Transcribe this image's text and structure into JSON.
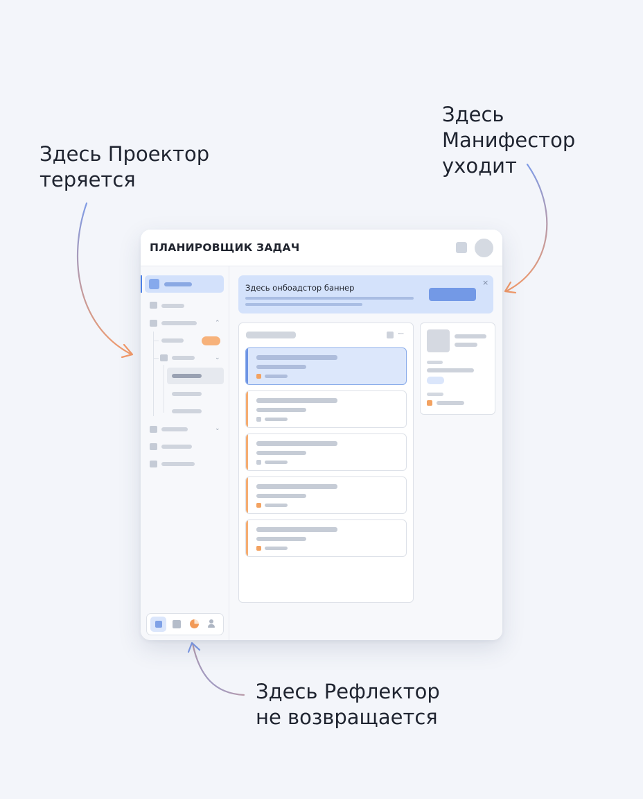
{
  "callouts": {
    "left": {
      "line1": "Здесь Проектор",
      "line2": "теряется"
    },
    "right": {
      "line1": "Здесь",
      "line2": "Манифестор",
      "line3": "уходит"
    },
    "bottom": {
      "line1": "Здесь Рефлектор",
      "line2": "не возвращается"
    }
  },
  "app": {
    "title": "ПЛАНИРОВЩИК ЗАДАЧ"
  },
  "banner": {
    "title": "Здесь онбоадстор баннер",
    "close_symbol": "×"
  },
  "list_panel": {
    "more_symbol": "···",
    "cards": [
      {
        "state": "selected",
        "tag": "orange"
      },
      {
        "state": "normal",
        "tag": "grey"
      },
      {
        "state": "normal",
        "tag": "grey"
      },
      {
        "state": "normal",
        "tag": "orange"
      },
      {
        "state": "normal",
        "tag": "orange"
      }
    ]
  },
  "sidebar": {
    "chevron_up": "⌃",
    "chevron_down": "⌄"
  },
  "bottom_nav": {
    "items": [
      "home-icon",
      "grid-icon",
      "pie-chart-icon",
      "user-icon"
    ],
    "active": "home-icon"
  },
  "colors": {
    "accent": "#4d80e6",
    "accent_light": "#d4e2fb",
    "warning": "#f3a261",
    "arrow_start": "#7f9be6",
    "arrow_end": "#f29a6a"
  }
}
